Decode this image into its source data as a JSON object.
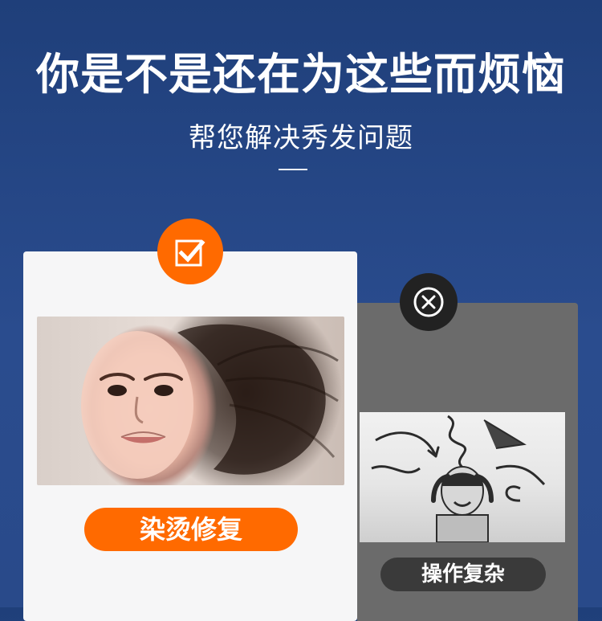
{
  "hero": {
    "headline": "你是不是还在为这些而烦恼",
    "subheadline": "帮您解决秀发问题"
  },
  "cards": {
    "good": {
      "badge_icon": "checkbox-checked-icon",
      "photo_icon": "woman-hair-photo",
      "label": "染烫修复",
      "accent": "#ff6a00"
    },
    "bad": {
      "badge_icon": "circle-x-icon",
      "photo_icon": "stressed-person-photo",
      "label": "操作复杂",
      "accent": "#3a3a3a"
    }
  }
}
